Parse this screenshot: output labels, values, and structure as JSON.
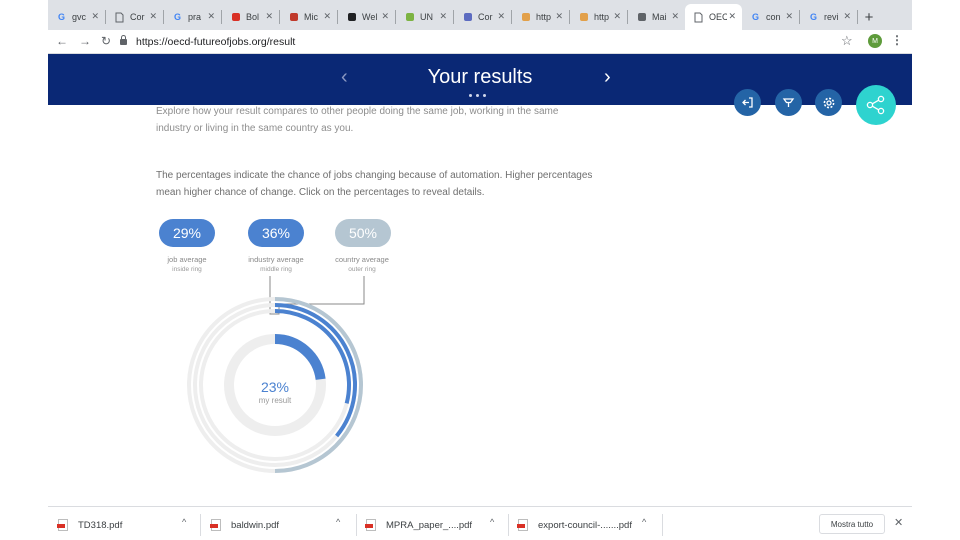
{
  "browser": {
    "tabs": [
      {
        "icon": "G",
        "icon_color": "#4285f4",
        "label": "gvc"
      },
      {
        "icon": "doc",
        "icon_color": "#5f6368",
        "label": "Cor"
      },
      {
        "icon": "G",
        "icon_color": "#4285f4",
        "label": "pra"
      },
      {
        "icon": "pdf",
        "icon_color": "#d93025",
        "label": "Bol"
      },
      {
        "icon": "mi",
        "icon_color": "#c0392b",
        "label": "Mic"
      },
      {
        "icon": "W",
        "icon_color": "#202124",
        "label": "Wel"
      },
      {
        "icon": "un",
        "icon_color": "#7cb342",
        "label": "UN"
      },
      {
        "icon": "co",
        "icon_color": "#5c6bc0",
        "label": "Cor"
      },
      {
        "icon": "ht",
        "icon_color": "#e2a04a",
        "label": "http"
      },
      {
        "icon": "ht",
        "icon_color": "#e2a04a",
        "label": "http"
      },
      {
        "icon": "ma",
        "icon_color": "#5f6368",
        "label": "Mai"
      },
      {
        "icon": "doc",
        "icon_color": "#5f6368",
        "label": "OEC",
        "active": true
      },
      {
        "icon": "G",
        "icon_color": "#4285f4",
        "label": "con"
      },
      {
        "icon": "G",
        "icon_color": "#4285f4",
        "label": "revi"
      }
    ],
    "close_glyph": "✕",
    "new_tab_glyph": "+",
    "back_glyph": "←",
    "forward_glyph": "→",
    "reload_glyph": "↻",
    "url": "https://oecd-futureofjobs.org/result",
    "star_glyph": "☆",
    "avatar_initial": "M",
    "menu_glyph": "⋮"
  },
  "header": {
    "title": "Your results",
    "prev_glyph": "‹",
    "next_glyph": "›",
    "bg_color": "#0a2875"
  },
  "content": {
    "intro": "Explore how your result compares to other people doing the same job, working in the same industry or living in the same country as you.",
    "note": "The percentages indicate the chance of jobs changing because of automation. Higher percentages mean higher chance of change. Click on the percentages to reveal details."
  },
  "comparisons": [
    {
      "value": "29%",
      "label": "job average",
      "ring": "inside ring",
      "percent": 29,
      "color": "#4b82d0"
    },
    {
      "value": "36%",
      "label": "industry average",
      "ring": "middle ring",
      "percent": 36,
      "color": "#4b82d0"
    },
    {
      "value": "50%",
      "label": "country average",
      "ring": "outer ring",
      "percent": 50,
      "color": "#b5c6d2"
    }
  ],
  "my_result": {
    "value": "23%",
    "label": "my result",
    "percent": 23,
    "color": "#4b82d0"
  },
  "actions": [
    {
      "name": "exit-icon"
    },
    {
      "name": "pin-icon"
    },
    {
      "name": "gear-icon"
    },
    {
      "name": "share-icon"
    }
  ],
  "downloads": [
    {
      "name": "TD318.pdf"
    },
    {
      "name": "baldwin.pdf"
    },
    {
      "name": "MPRA_paper_....pdf"
    },
    {
      "name": "export-council-.......pdf"
    }
  ],
  "downloads_caret": "^",
  "show_all_label": "Mostra tutto",
  "shelf_close_glyph": "✕"
}
